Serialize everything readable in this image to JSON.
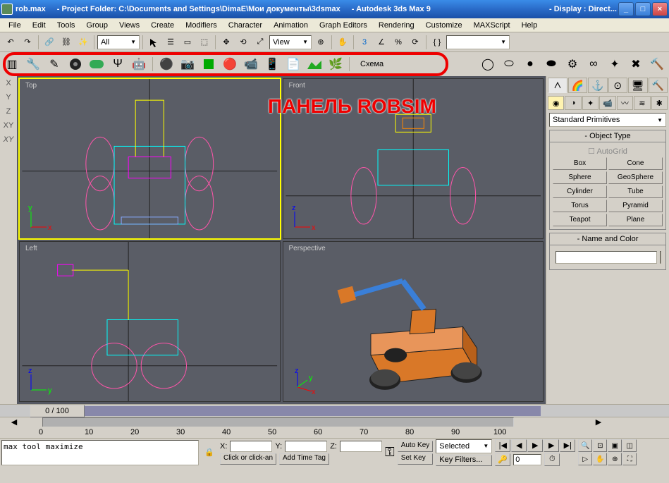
{
  "title": {
    "filename": "rob.max",
    "project": "- Project Folder: C:\\Documents and Settings\\DimaE\\Мои документы\\3dsmax",
    "app": "- Autodesk 3ds Max 9",
    "display": "- Display : Direct..."
  },
  "menu": [
    "File",
    "Edit",
    "Tools",
    "Group",
    "Views",
    "Create",
    "Modifiers",
    "Character",
    "Animation",
    "Graph Editors",
    "Rendering",
    "Customize",
    "MAXScript",
    "Help"
  ],
  "toolbar_selectors": {
    "selection_filter": "All",
    "ref_coord": "View"
  },
  "robsim": {
    "schema_label": "Схема"
  },
  "annotation": "ПАНЕЛЬ ROBSIM",
  "viewports": {
    "top": "Top",
    "front": "Front",
    "left": "Left",
    "persp": "Perspective"
  },
  "left_axis_labels": [
    "X",
    "Y",
    "Z",
    "XY",
    "XY"
  ],
  "command_panel": {
    "dropdown": "Standard Primitives",
    "rollout_object": "Object Type",
    "autogrid": "AutoGrid",
    "buttons": [
      "Box",
      "Cone",
      "Sphere",
      "GeoSphere",
      "Cylinder",
      "Tube",
      "Torus",
      "Pyramid",
      "Teapot",
      "Plane"
    ],
    "rollout_name": "Name and Color"
  },
  "timeline": {
    "handle": "0 / 100",
    "ticks": [
      "0",
      "10",
      "20",
      "30",
      "40",
      "50",
      "60",
      "70",
      "80",
      "90",
      "100"
    ]
  },
  "status": {
    "prompt": "max tool maximize",
    "click_hint": "Click or click-an",
    "add_tag": "Add Time Tag",
    "x": "X:",
    "y": "Y:",
    "z": "Z:",
    "autokey": "Auto Key",
    "setkey": "Set Key",
    "selected": "Selected",
    "keyfilters": "Key Filters...",
    "frame": "0"
  }
}
